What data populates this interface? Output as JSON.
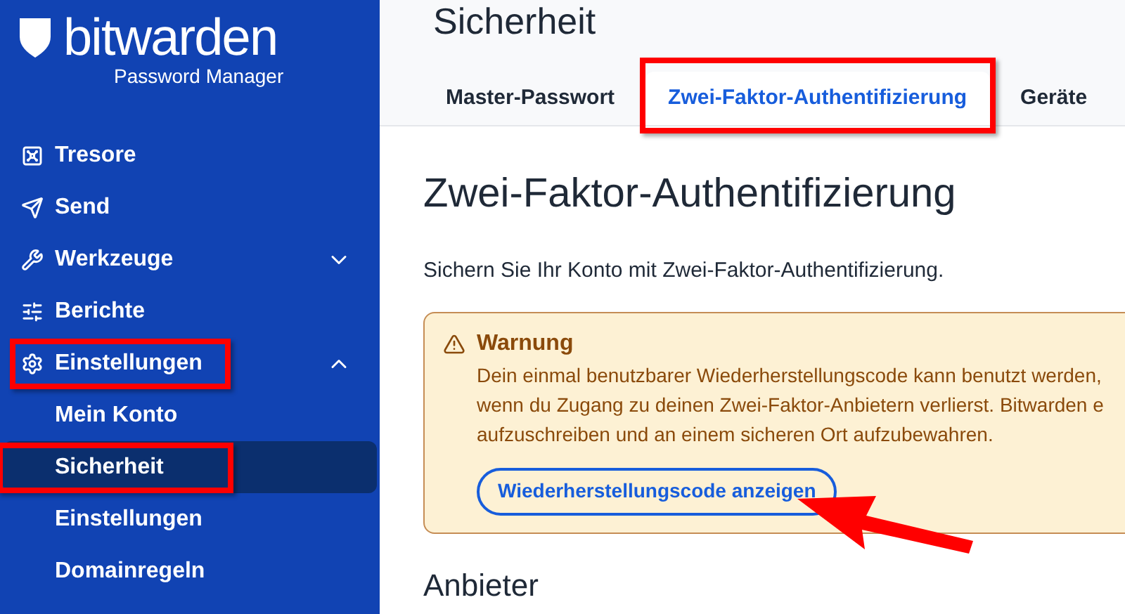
{
  "logo": {
    "wordmark": "**bit**warden",
    "subtitle": "Password Manager"
  },
  "sidebar": {
    "items": [
      {
        "label": "Tresore",
        "selected": false,
        "highlighted": false
      },
      {
        "label": "Send",
        "selected": false,
        "highlighted": false
      },
      {
        "label": "Werkzeuge",
        "selected": false,
        "highlighted": false,
        "expanded": false
      },
      {
        "label": "Berichte",
        "selected": false,
        "highlighted": false
      },
      {
        "label": "Einstellungen",
        "selected": false,
        "highlighted": true,
        "expanded": true,
        "children": [
          {
            "label": "Mein Konto",
            "selected": false,
            "highlighted": false
          },
          {
            "label": "Sicherheit",
            "selected": true,
            "highlighted": true
          },
          {
            "label": "Einstellungen",
            "selected": false,
            "highlighted": false
          },
          {
            "label": "Domainregeln",
            "selected": false,
            "highlighted": false
          }
        ]
      }
    ]
  },
  "page_title": "Sicherheit",
  "tabs": [
    {
      "label": "Master-Passwort",
      "selected": false,
      "highlighted": false
    },
    {
      "label": "Zwei-Faktor-Authentifizierung",
      "selected": true,
      "highlighted": true
    },
    {
      "label": "Geräte",
      "selected": false,
      "highlighted": false
    }
  ],
  "section": {
    "title": "Zwei-Faktor-Authentifizierung",
    "description": "Sichern Sie Ihr Konto mit Zwei-Faktor-Authentifizierung.",
    "warning": {
      "title": "Warnung",
      "lines": [
        "Dein einmal benutzbarer Wiederherstellungscode kann benutzt werden,",
        "wenn du Zugang zu deinen Zwei-Faktor-Anbietern verlierst. Bitwarden e",
        "aufzuschreiben und an einem sicheren Ort aufzubewahren."
      ],
      "button": {
        "label": "Wiederherstellungscode anzeigen",
        "pointed_at": true
      }
    },
    "subsection_title": "Anbieter"
  }
}
